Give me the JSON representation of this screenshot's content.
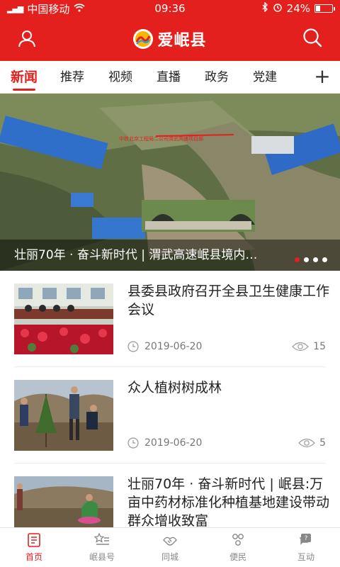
{
  "status_bar": {
    "carrier": "中国移动",
    "time": "09:36",
    "battery": "24%",
    "battery_level": 0.24
  },
  "header": {
    "title": "爱岷县"
  },
  "tabs": [
    {
      "label": "新闻",
      "active": true
    },
    {
      "label": "推荐",
      "active": false
    },
    {
      "label": "视频",
      "active": false
    },
    {
      "label": "直播",
      "active": false
    },
    {
      "label": "政务",
      "active": false
    },
    {
      "label": "党建",
      "active": false
    }
  ],
  "tab_add_symbol": "+",
  "banner": {
    "caption": "壮丽70年 · 奋斗新时代 | 渭武高速岷县境内…",
    "sign_text": "中铁北京工程局二公司渭武高速项目部",
    "slides_count": 4,
    "active_slide": 0
  },
  "news": [
    {
      "title": "县委县政府召开全县卫生健康工作会议",
      "date": "2019-06-20",
      "views": "15"
    },
    {
      "title": "众人植树树成林",
      "date": "2019-06-20",
      "views": "5"
    },
    {
      "title": "壮丽70年 · 奋斗新时代 | 岷县:万亩中药材标准化种植基地建设带动群众增收致富",
      "date": "",
      "views": ""
    }
  ],
  "bottom_nav": [
    {
      "label": "首页",
      "icon": "home-icon",
      "active": true
    },
    {
      "label": "岷县号",
      "icon": "star-list-icon",
      "active": false
    },
    {
      "label": "同城",
      "icon": "handshake-icon",
      "active": false
    },
    {
      "label": "便民",
      "icon": "people-icon",
      "active": false
    },
    {
      "label": "互动",
      "icon": "chat-icon",
      "active": false
    }
  ],
  "colors": {
    "brand_red": "#e4201f",
    "inactive_gray": "#888888"
  }
}
